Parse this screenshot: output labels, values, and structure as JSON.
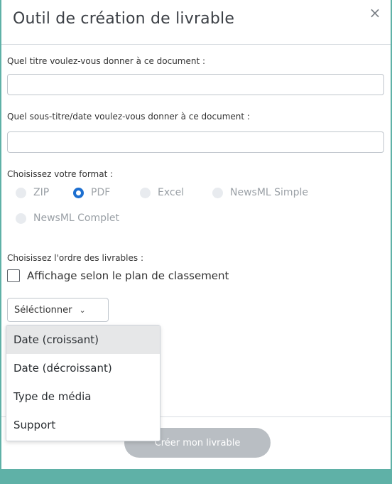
{
  "modal": {
    "title": "Outil de création de livrable",
    "close_label": "×"
  },
  "fields": {
    "title_label": "Quel titre voulez-vous donner à ce document :",
    "title_value": "",
    "subtitle_label": "Quel sous-titre/date voulez-vous donner à ce document :",
    "subtitle_value": ""
  },
  "format": {
    "label": "Choisissez votre format :",
    "options": [
      {
        "label": "ZIP",
        "checked": false
      },
      {
        "label": "PDF",
        "checked": true
      },
      {
        "label": "Excel",
        "checked": false
      },
      {
        "label": "NewsML Simple",
        "checked": false
      },
      {
        "label": "NewsML Complet",
        "checked": false
      }
    ]
  },
  "order": {
    "label": "Choisissez l'ordre des livrables :",
    "checkbox_label": "Affichage selon le plan de classement",
    "checkbox_checked": false,
    "select_value": "Séléctionner",
    "dropdown_items": [
      "Date (croissant)",
      "Date (décroissant)",
      "Type de média",
      "Support"
    ]
  },
  "actions": {
    "create_label": "Créer mon livrable"
  },
  "colors": {
    "accent": "#5fb1a7",
    "radio_checked": "#1d6fd0",
    "button_bg": "#b9bec3"
  }
}
